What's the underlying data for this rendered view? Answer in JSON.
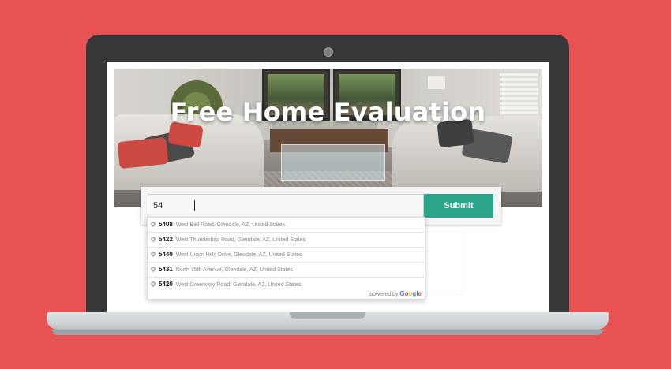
{
  "hero": {
    "title": "Free Home Evaluation"
  },
  "search": {
    "value": "54"
  },
  "submit_label": "Submit",
  "suggestions": [
    {
      "match": "54",
      "rest": "08",
      "address": "West Bell Road, Glendale, AZ, United States"
    },
    {
      "match": "54",
      "rest": "22",
      "address": "West Thunderbird Road, Glendale, AZ, United States"
    },
    {
      "match": "54",
      "rest": "40",
      "address": "West Union Hills Drive, Glendale, AZ, United States"
    },
    {
      "match": "54",
      "rest": "31",
      "address": "North 75th Avenue, Glendale, AZ, United States"
    },
    {
      "match": "54",
      "rest": "20",
      "address": "West Greenway Road, Glendale, AZ, United States"
    }
  ],
  "autocomplete_footer": {
    "powered_by": "powered by",
    "brand": "Google"
  },
  "icons": {
    "suggestion": "map-pin-icon"
  },
  "colors": {
    "background": "#e85252",
    "submit": "#2aa58a",
    "laptop_frame": "#353739"
  }
}
